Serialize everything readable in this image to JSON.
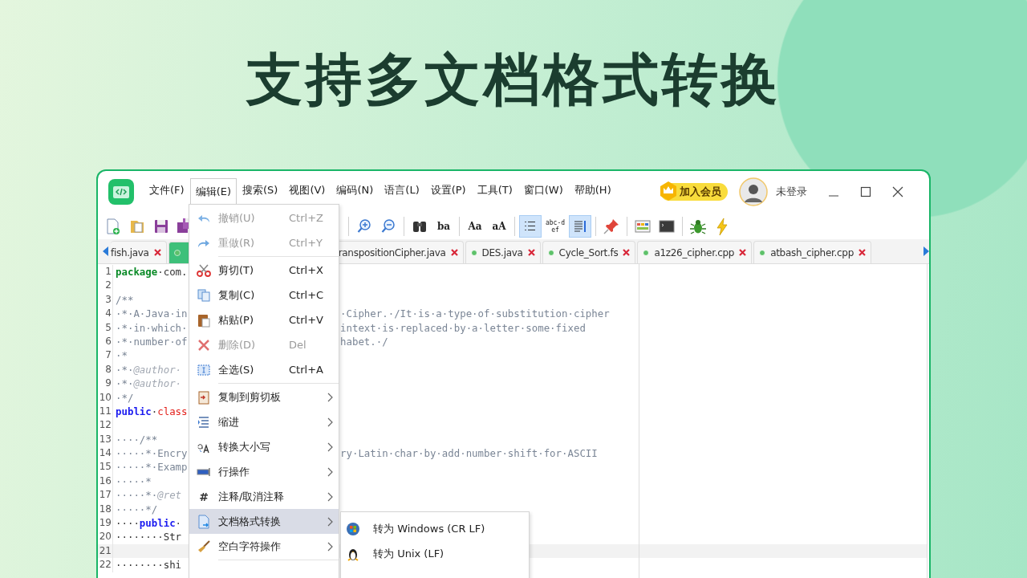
{
  "headline": "支持多文档格式转换",
  "menubar": [
    {
      "label": "文件(F)",
      "selected": false
    },
    {
      "label": "编辑(E)",
      "selected": true
    },
    {
      "label": "搜索(S)",
      "selected": false
    },
    {
      "label": "视图(V)",
      "selected": false
    },
    {
      "label": "编码(N)",
      "selected": false
    },
    {
      "label": "语言(L)",
      "selected": false
    },
    {
      "label": "设置(P)",
      "selected": false
    },
    {
      "label": "工具(T)",
      "selected": false
    },
    {
      "label": "窗口(W)",
      "selected": false
    },
    {
      "label": "帮助(H)",
      "selected": false
    }
  ],
  "vip_badge": "加入会员",
  "user": "未登录",
  "toolbar": [
    {
      "kind": "new"
    },
    {
      "kind": "open"
    },
    {
      "kind": "save"
    },
    {
      "kind": "save-all"
    },
    {
      "kind": "separator"
    },
    {
      "kind": "zoom-in"
    },
    {
      "kind": "zoom-out"
    },
    {
      "kind": "separator"
    },
    {
      "kind": "find"
    },
    {
      "kind": "text",
      "text": "ba"
    },
    {
      "kind": "separator"
    },
    {
      "kind": "text",
      "text": "Aa"
    },
    {
      "kind": "text",
      "text": "aA"
    },
    {
      "kind": "separator"
    },
    {
      "kind": "line-numbers",
      "on": true
    },
    {
      "kind": "text-toggle",
      "text": "abc-def",
      "on": false
    },
    {
      "kind": "wrap",
      "on": true
    },
    {
      "kind": "separator"
    },
    {
      "kind": "pin"
    },
    {
      "kind": "separator"
    },
    {
      "kind": "panel"
    },
    {
      "kind": "console"
    },
    {
      "kind": "separator"
    },
    {
      "kind": "bug"
    },
    {
      "kind": "bolt"
    }
  ],
  "tabs": [
    {
      "label": "fish.java",
      "selected": false,
      "dot": false
    },
    {
      "selected": true,
      "dot": true
    },
    {
      "label": "ranspositionCipher.java",
      "selected": false,
      "dot": false
    },
    {
      "label": "DES.java",
      "selected": false,
      "dot": true
    },
    {
      "label": "Cycle_Sort.fs",
      "selected": false,
      "dot": true
    },
    {
      "label": "a1z26_cipher.cpp",
      "selected": false,
      "dot": true
    },
    {
      "label": "atbash_cipher.cpp",
      "selected": false,
      "dot": true
    }
  ],
  "code_lines": [
    {
      "num": "1",
      "current": false,
      "left": [
        {
          "text": "package",
          "kind": "package"
        },
        {
          "text": "·com.",
          "kind": "plain"
        }
      ]
    },
    {
      "num": "2",
      "current": false
    },
    {
      "num": "3",
      "current": false,
      "left": [
        {
          "text": "/**",
          "kind": "comment"
        }
      ]
    },
    {
      "num": "4",
      "current": false,
      "left": [
        {
          "text": "·*·A·Java·in",
          "kind": "comment"
        }
      ],
      "right": [
        {
          "text": "·Cipher.·/It·is·a·type·of·substitution·cipher",
          "kind": "comment"
        }
      ]
    },
    {
      "num": "5",
      "current": false,
      "left": [
        {
          "text": "·*·in·which·",
          "kind": "comment"
        }
      ],
      "right": [
        {
          "text": "intext·is·replaced·by·a·letter·some·fixed",
          "kind": "comment"
        }
      ]
    },
    {
      "num": "6",
      "current": false,
      "left": [
        {
          "text": "·*·number·of",
          "kind": "comment"
        }
      ],
      "right": [
        {
          "text": "habet.·/",
          "kind": "comment"
        }
      ]
    },
    {
      "num": "7",
      "current": false,
      "left": [
        {
          "text": "·*",
          "kind": "comment"
        }
      ]
    },
    {
      "num": "8",
      "current": false,
      "left": [
        {
          "text": "·*·",
          "kind": "comment"
        },
        {
          "text": "@author·",
          "kind": "doc-tag"
        }
      ]
    },
    {
      "num": "9",
      "current": false,
      "left": [
        {
          "text": "·*·",
          "kind": "comment"
        },
        {
          "text": "@author·",
          "kind": "doc-tag"
        }
      ]
    },
    {
      "num": "10",
      "current": false,
      "left": [
        {
          "text": "·*/",
          "kind": "comment"
        }
      ]
    },
    {
      "num": "11",
      "current": false,
      "left": [
        {
          "text": "public",
          "kind": "modifier"
        },
        {
          "text": "·",
          "kind": "plain"
        },
        {
          "text": "class",
          "kind": "declaration"
        }
      ]
    },
    {
      "num": "12",
      "current": false
    },
    {
      "num": "13",
      "current": false,
      "left": [
        {
          "text": "····/**",
          "kind": "comment"
        }
      ]
    },
    {
      "num": "14",
      "current": false,
      "left": [
        {
          "text": "·····*·Encry",
          "kind": "comment"
        }
      ],
      "right": [
        {
          "text": "ry·Latin·char·by·add·number·shift·for·ASCII",
          "kind": "comment"
        }
      ]
    },
    {
      "num": "15",
      "current": false,
      "left": [
        {
          "text": "·····*·Examp",
          "kind": "comment"
        }
      ]
    },
    {
      "num": "16",
      "current": false,
      "left": [
        {
          "text": "·····*",
          "kind": "comment"
        }
      ]
    },
    {
      "num": "17",
      "current": false,
      "left": [
        {
          "text": "·····*·",
          "kind": "comment"
        },
        {
          "text": "@ret",
          "kind": "doc-tag"
        }
      ]
    },
    {
      "num": "18",
      "current": false,
      "left": [
        {
          "text": "·····*/",
          "kind": "comment"
        }
      ]
    },
    {
      "num": "19",
      "current": false,
      "left": [
        {
          "text": "····",
          "kind": "plain"
        },
        {
          "text": "public",
          "kind": "modifier"
        },
        {
          "text": "·",
          "kind": "plain"
        }
      ]
    },
    {
      "num": "20",
      "current": false,
      "left": [
        {
          "text": "········Str",
          "kind": "plain"
        }
      ]
    },
    {
      "num": "21",
      "current": true
    },
    {
      "num": "22",
      "current": false,
      "left": [
        {
          "text": "········shi",
          "kind": "plain"
        }
      ]
    }
  ],
  "edit_menu": [
    {
      "kind": "command",
      "label": "撤销(U)",
      "shortcut": "Ctrl+Z",
      "disabled": true,
      "selected": false
    },
    {
      "kind": "command",
      "label": "重做(R)",
      "shortcut": "Ctrl+Y",
      "disabled": true,
      "selected": false
    },
    {
      "kind": "separator"
    },
    {
      "kind": "command",
      "label": "剪切(T)",
      "shortcut": "Ctrl+X",
      "disabled": false,
      "selected": false
    },
    {
      "kind": "command",
      "label": "复制(C)",
      "shortcut": "Ctrl+C",
      "disabled": false,
      "selected": false
    },
    {
      "kind": "command",
      "label": "粘贴(P)",
      "shortcut": "Ctrl+V",
      "disabled": false,
      "selected": false
    },
    {
      "kind": "command",
      "label": "删除(D)",
      "shortcut": "Del",
      "disabled": true,
      "selected": false
    },
    {
      "kind": "command",
      "label": "全选(S)",
      "shortcut": "Ctrl+A",
      "disabled": false,
      "selected": false
    },
    {
      "kind": "separator"
    },
    {
      "kind": "submenu",
      "label": "复制到剪切板",
      "disabled": false,
      "selected": false
    },
    {
      "kind": "submenu",
      "label": "缩进",
      "disabled": false,
      "selected": false
    },
    {
      "kind": "submenu",
      "label": "转换大小写",
      "disabled": false,
      "selected": false
    },
    {
      "kind": "submenu",
      "label": "行操作",
      "disabled": false,
      "selected": false
    },
    {
      "kind": "submenu",
      "label": "注释/取消注释",
      "glyph": "#",
      "disabled": false,
      "selected": false
    },
    {
      "kind": "submenu",
      "label": "文档格式转换",
      "disabled": false,
      "selected": true
    },
    {
      "kind": "submenu",
      "label": "空白字符操作",
      "disabled": false,
      "selected": false
    },
    {
      "kind": "separator"
    }
  ],
  "format_submenu": [
    {
      "label": "转为 Windows (CR LF)"
    },
    {
      "label": "转为 Unix (LF)"
    }
  ]
}
